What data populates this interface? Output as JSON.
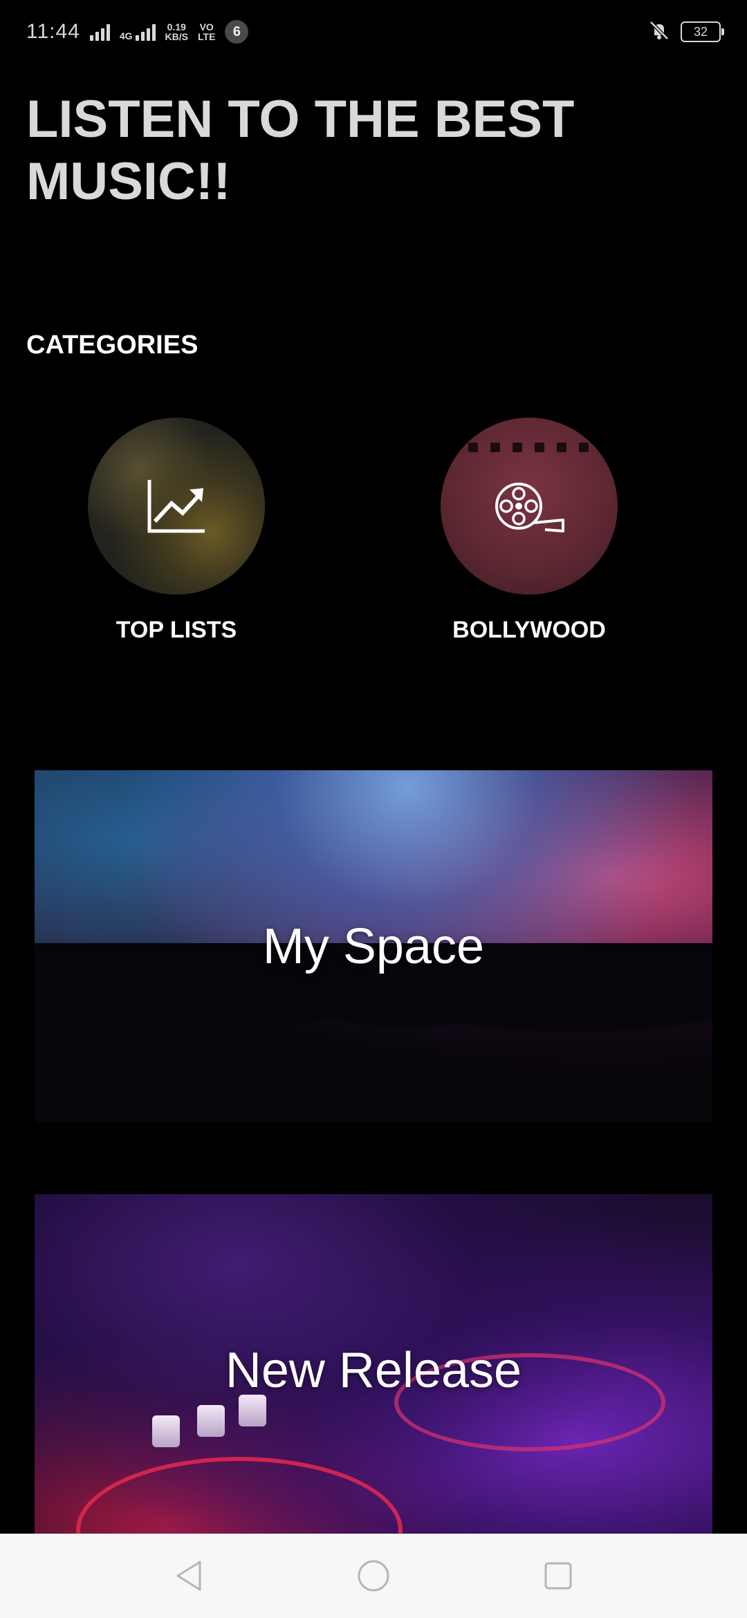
{
  "status_bar": {
    "time": "11:44",
    "network_4g": "4G",
    "data_speed": "0.19",
    "data_speed_unit": "KB/S",
    "volte_top": "VO",
    "volte_bottom": "LTE",
    "notification_count": "6",
    "battery": "32"
  },
  "header": {
    "title": "LISTEN TO THE BEST MUSIC!!"
  },
  "categories": {
    "label": "CATEGORIES",
    "items": [
      {
        "label": "TOP LISTS",
        "icon": "trending-up-icon"
      },
      {
        "label": "BOLLYWOOD",
        "icon": "film-reel-icon"
      }
    ]
  },
  "banners": [
    {
      "title": "My Space"
    },
    {
      "title": "New Release"
    }
  ],
  "colors": {
    "background": "#000000",
    "headline": "#d9d9d9",
    "nav_bar": "#f7f7f7"
  }
}
